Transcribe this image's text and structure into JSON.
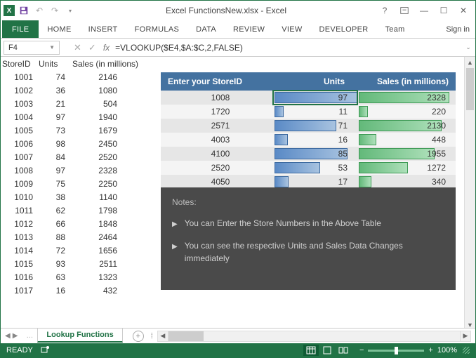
{
  "window": {
    "title": "Excel FunctionsNew.xlsx - Excel",
    "signin": "Sign in"
  },
  "tabs": [
    "FILE",
    "HOME",
    "INSERT",
    "FORMULAS",
    "DATA",
    "REVIEW",
    "VIEW",
    "DEVELOPER",
    "Team"
  ],
  "namebox": "F4",
  "formula": "=VLOOKUP($E4,$A:$C,2,FALSE)",
  "headers": {
    "c1": "StoreID",
    "c2": "Units",
    "c3": "Sales (in millions)"
  },
  "rows": [
    {
      "id": "1001",
      "u": "74",
      "s": "2146"
    },
    {
      "id": "1002",
      "u": "36",
      "s": "1080"
    },
    {
      "id": "1003",
      "u": "21",
      "s": "504"
    },
    {
      "id": "1004",
      "u": "97",
      "s": "1940"
    },
    {
      "id": "1005",
      "u": "73",
      "s": "1679"
    },
    {
      "id": "1006",
      "u": "98",
      "s": "2450"
    },
    {
      "id": "1007",
      "u": "84",
      "s": "2520"
    },
    {
      "id": "1008",
      "u": "97",
      "s": "2328"
    },
    {
      "id": "1009",
      "u": "75",
      "s": "2250"
    },
    {
      "id": "1010",
      "u": "38",
      "s": "1140"
    },
    {
      "id": "1011",
      "u": "62",
      "s": "1798"
    },
    {
      "id": "1012",
      "u": "66",
      "s": "1848"
    },
    {
      "id": "1013",
      "u": "88",
      "s": "2464"
    },
    {
      "id": "1014",
      "u": "72",
      "s": "1656"
    },
    {
      "id": "1015",
      "u": "93",
      "s": "2511"
    },
    {
      "id": "1016",
      "u": "63",
      "s": "1323"
    },
    {
      "id": "1017",
      "u": "16",
      "s": "432"
    }
  ],
  "lookup": {
    "head": {
      "c1": "Enter your StoreID",
      "c2": "Units",
      "c3": "Sales (in millions)"
    },
    "rows": [
      {
        "id": "1008",
        "u": "97",
        "s": "2328",
        "ub": 99,
        "sb": 92
      },
      {
        "id": "1720",
        "u": "11",
        "s": "220",
        "ub": 11,
        "sb": 9
      },
      {
        "id": "2571",
        "u": "71",
        "s": "2130",
        "ub": 73,
        "sb": 84
      },
      {
        "id": "4003",
        "u": "16",
        "s": "448",
        "ub": 16,
        "sb": 18
      },
      {
        "id": "4100",
        "u": "85",
        "s": "1955",
        "ub": 87,
        "sb": 77
      },
      {
        "id": "2520",
        "u": "53",
        "s": "1272",
        "ub": 54,
        "sb": 50
      },
      {
        "id": "4050",
        "u": "17",
        "s": "340",
        "ub": 17,
        "sb": 13
      }
    ]
  },
  "notes": {
    "title": "Notes:",
    "items": [
      "You can Enter the Store Numbers in the Above Table",
      "You can see the respective Units and Sales Data Changes immediately"
    ]
  },
  "sheettab": "Lookup Functions",
  "status": {
    "ready": "READY",
    "zoom": "100%"
  },
  "chart_data": {
    "type": "table",
    "title": "Store Units and Sales",
    "columns": [
      "StoreID",
      "Units",
      "Sales (in millions)"
    ],
    "rows": [
      [
        1001,
        74,
        2146
      ],
      [
        1002,
        36,
        1080
      ],
      [
        1003,
        21,
        504
      ],
      [
        1004,
        97,
        1940
      ],
      [
        1005,
        73,
        1679
      ],
      [
        1006,
        98,
        2450
      ],
      [
        1007,
        84,
        2520
      ],
      [
        1008,
        97,
        2328
      ],
      [
        1009,
        75,
        2250
      ],
      [
        1010,
        38,
        1140
      ],
      [
        1011,
        62,
        1798
      ],
      [
        1012,
        66,
        1848
      ],
      [
        1013,
        88,
        2464
      ],
      [
        1014,
        72,
        1656
      ],
      [
        1015,
        93,
        2511
      ],
      [
        1016,
        63,
        1323
      ],
      [
        1017,
        16,
        432
      ]
    ],
    "lookup_table": {
      "columns": [
        "Enter your StoreID",
        "Units",
        "Sales (in millions)"
      ],
      "rows": [
        [
          1008,
          97,
          2328
        ],
        [
          1720,
          11,
          220
        ],
        [
          2571,
          71,
          2130
        ],
        [
          4003,
          16,
          448
        ],
        [
          4100,
          85,
          1955
        ],
        [
          2520,
          53,
          1272
        ],
        [
          4050,
          17,
          340
        ]
      ]
    }
  }
}
